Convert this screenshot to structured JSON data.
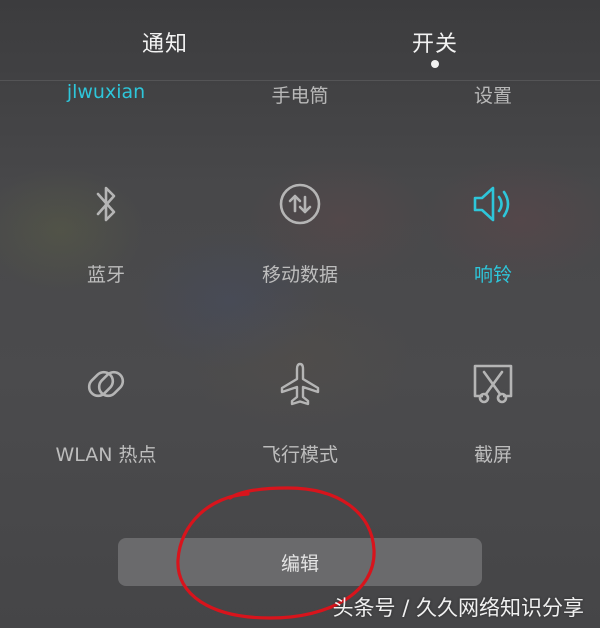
{
  "tabs": [
    {
      "label": "通知",
      "active": false
    },
    {
      "label": "开关",
      "active": true
    }
  ],
  "top_row": {
    "wifi_name": "jlwuxian",
    "flashlight": "手电筒",
    "settings": "设置"
  },
  "tiles": {
    "bluetooth": {
      "label": "蓝牙",
      "icon": "bluetooth-icon",
      "active": false
    },
    "mobile_data": {
      "label": "移动数据",
      "icon": "mobile-data-icon",
      "active": false
    },
    "ringer": {
      "label": "响铃",
      "icon": "speaker-icon",
      "active": true
    },
    "hotspot": {
      "label": "WLAN 热点",
      "icon": "hotspot-icon",
      "active": false
    },
    "airplane": {
      "label": "飞行模式",
      "icon": "airplane-icon",
      "active": false
    },
    "screenshot": {
      "label": "截屏",
      "icon": "screenshot-icon",
      "active": false
    }
  },
  "edit_button": {
    "label": "编辑"
  },
  "watermark": "头条号 / 久久网络知识分享",
  "colors": {
    "accent": "#2ec6da",
    "icon_inactive": "#b5b5b5",
    "annotation": "#d8141c"
  }
}
